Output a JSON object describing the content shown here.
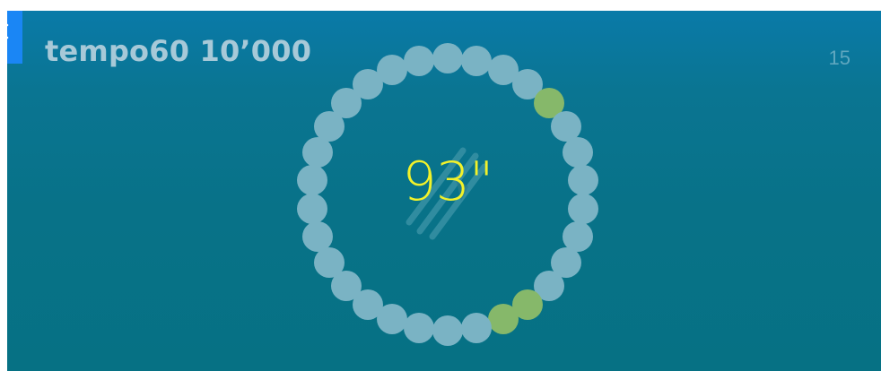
{
  "title": "tempo60 10’000",
  "count": "15",
  "timer": "93\"",
  "ring": {
    "total_dots": 30,
    "completed_dots": [
      4,
      12,
      13
    ],
    "dot_color": "#7ab3c4",
    "completed_color": "#86b86a"
  },
  "colors": {
    "accent": "#1a86f5",
    "timer": "#f2f22a",
    "background": "#087288"
  },
  "icons": {
    "watermark": "stripes-logo-icon"
  }
}
